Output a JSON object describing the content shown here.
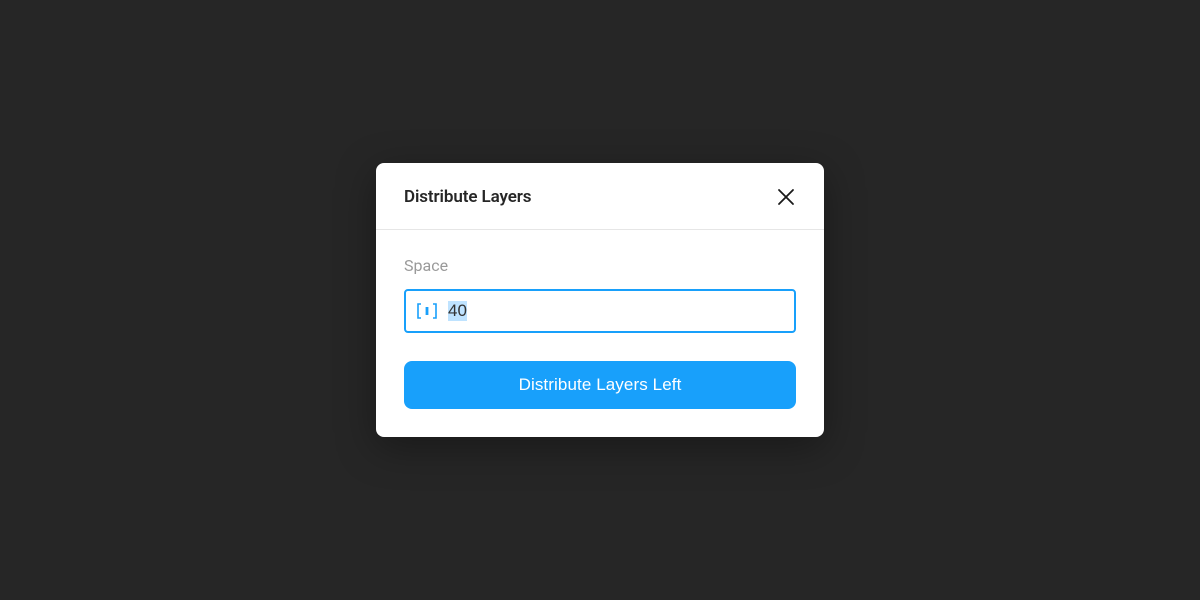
{
  "dialog": {
    "title": "Distribute Layers",
    "space_label": "Space",
    "space_value": "40",
    "submit_label": "Distribute Layers Left"
  },
  "colors": {
    "accent": "#18a0fb",
    "bg": "#262626"
  }
}
